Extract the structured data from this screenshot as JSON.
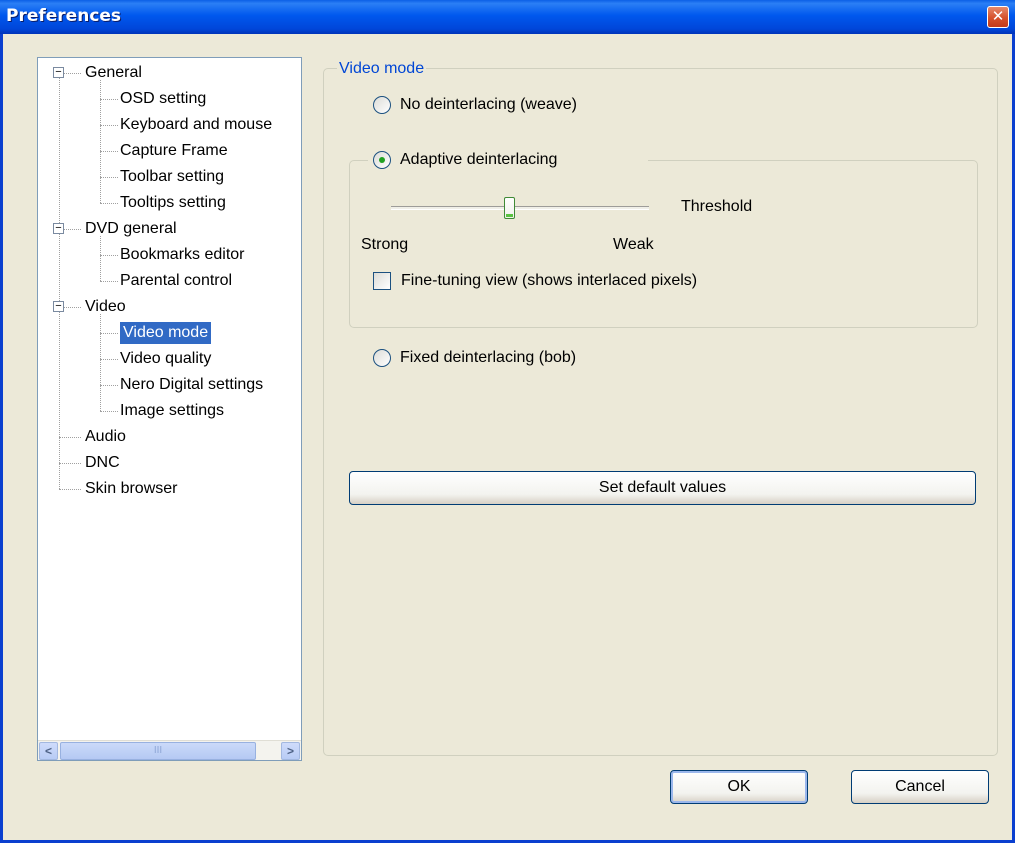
{
  "window": {
    "title": "Preferences",
    "close_glyph": "✕"
  },
  "tree": {
    "items": [
      {
        "label": "General",
        "level": 0,
        "expanded": true
      },
      {
        "label": "OSD setting",
        "level": 1
      },
      {
        "label": "Keyboard and mouse",
        "level": 1
      },
      {
        "label": "Capture Frame",
        "level": 1
      },
      {
        "label": "Toolbar setting",
        "level": 1
      },
      {
        "label": "Tooltips setting",
        "level": 1
      },
      {
        "label": "DVD general",
        "level": 0,
        "expanded": true
      },
      {
        "label": "Bookmarks editor",
        "level": 1
      },
      {
        "label": "Parental control",
        "level": 1
      },
      {
        "label": "Video",
        "level": 0,
        "expanded": true
      },
      {
        "label": "Video mode",
        "level": 1,
        "selected": true
      },
      {
        "label": "Video quality",
        "level": 1
      },
      {
        "label": "Nero Digital settings",
        "level": 1
      },
      {
        "label": "Image settings",
        "level": 1
      },
      {
        "label": "Audio",
        "level": 0
      },
      {
        "label": "DNC",
        "level": 0
      },
      {
        "label": "Skin browser",
        "level": 0
      }
    ],
    "scroll_left_glyph": "<",
    "scroll_right_glyph": ">",
    "scroll_thumb_grip": "III"
  },
  "video_mode": {
    "group_title": "Video mode",
    "options": {
      "weave": "No deinterlacing (weave)",
      "adaptive": "Adaptive deinterlacing",
      "bob": "Fixed deinterlacing (bob)"
    },
    "selected_option": "adaptive",
    "threshold_label": "Threshold",
    "strong_label": "Strong",
    "weak_label": "Weak",
    "threshold_level": 0.46,
    "fine_tuning_label": "Fine-tuning view (shows interlaced pixels)",
    "fine_tuning_checked": false,
    "default_button": "Set default values"
  },
  "buttons": {
    "ok": "OK",
    "cancel": "Cancel"
  },
  "colors": {
    "accent": "#0046d5",
    "selection": "#316ac5",
    "titlebar": "#0058ee"
  }
}
